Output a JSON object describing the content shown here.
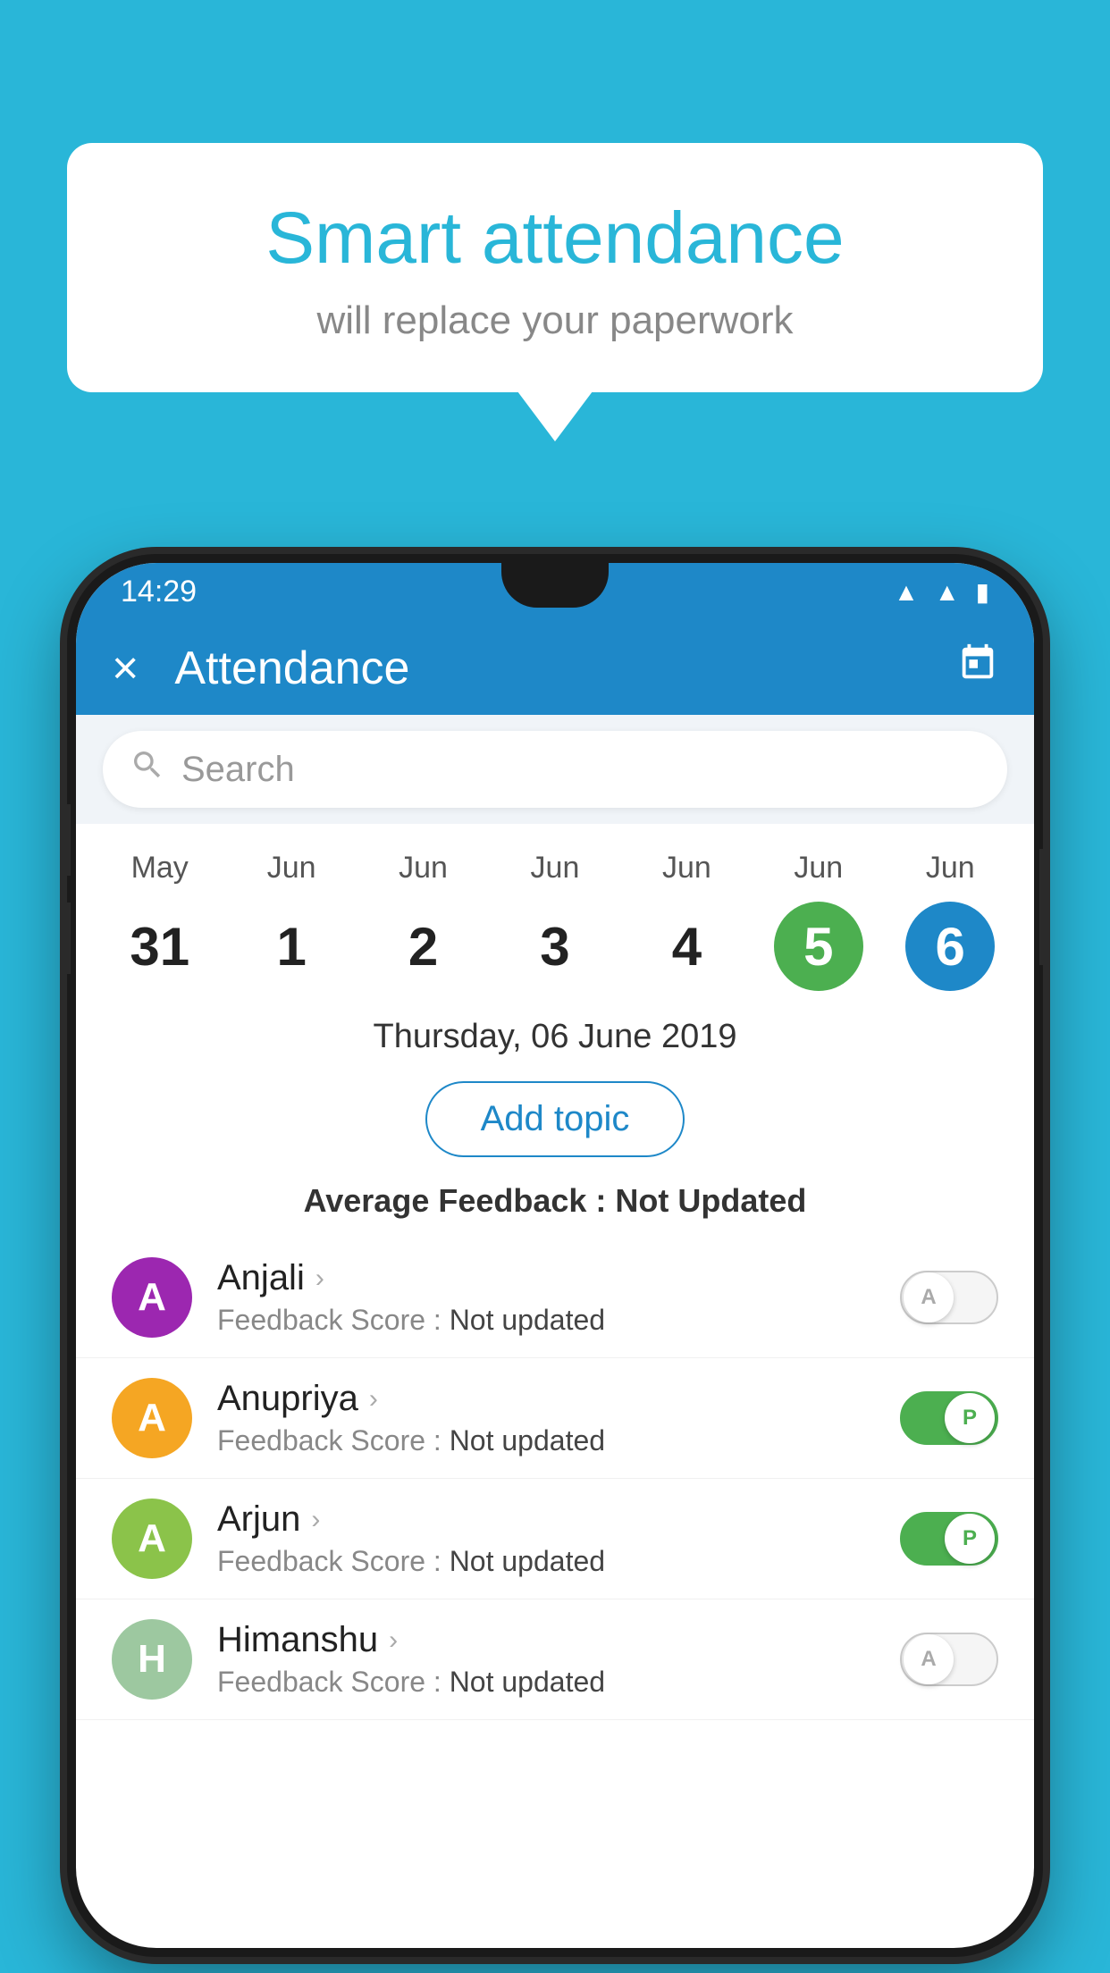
{
  "background_color": "#29b6d8",
  "speech_bubble": {
    "title": "Smart attendance",
    "subtitle": "will replace your paperwork"
  },
  "status_bar": {
    "time": "14:29",
    "icons": [
      "wifi",
      "signal",
      "battery"
    ]
  },
  "header": {
    "title": "Attendance",
    "close_label": "×",
    "calendar_icon": "📅"
  },
  "search": {
    "placeholder": "Search"
  },
  "calendar": {
    "days": [
      {
        "month": "May",
        "date": "31",
        "state": "normal"
      },
      {
        "month": "Jun",
        "date": "1",
        "state": "normal"
      },
      {
        "month": "Jun",
        "date": "2",
        "state": "normal"
      },
      {
        "month": "Jun",
        "date": "3",
        "state": "normal"
      },
      {
        "month": "Jun",
        "date": "4",
        "state": "normal"
      },
      {
        "month": "Jun",
        "date": "5",
        "state": "today"
      },
      {
        "month": "Jun",
        "date": "6",
        "state": "selected"
      }
    ]
  },
  "selected_date_label": "Thursday, 06 June 2019",
  "add_topic_label": "Add topic",
  "avg_feedback": {
    "label": "Average Feedback : ",
    "value": "Not Updated"
  },
  "students": [
    {
      "name": "Anjali",
      "avatar_letter": "A",
      "avatar_color": "#9c27b0",
      "feedback_label": "Feedback Score : ",
      "feedback_value": "Not updated",
      "toggle_state": "off",
      "toggle_label": "A"
    },
    {
      "name": "Anupriya",
      "avatar_letter": "A",
      "avatar_color": "#f5a623",
      "feedback_label": "Feedback Score : ",
      "feedback_value": "Not updated",
      "toggle_state": "on",
      "toggle_label": "P"
    },
    {
      "name": "Arjun",
      "avatar_letter": "A",
      "avatar_color": "#8bc34a",
      "feedback_label": "Feedback Score : ",
      "feedback_value": "Not updated",
      "toggle_state": "on",
      "toggle_label": "P"
    },
    {
      "name": "Himanshu",
      "avatar_letter": "H",
      "avatar_color": "#9dc8a0",
      "feedback_label": "Feedback Score : ",
      "feedback_value": "Not updated",
      "toggle_state": "off",
      "toggle_label": "A"
    }
  ]
}
